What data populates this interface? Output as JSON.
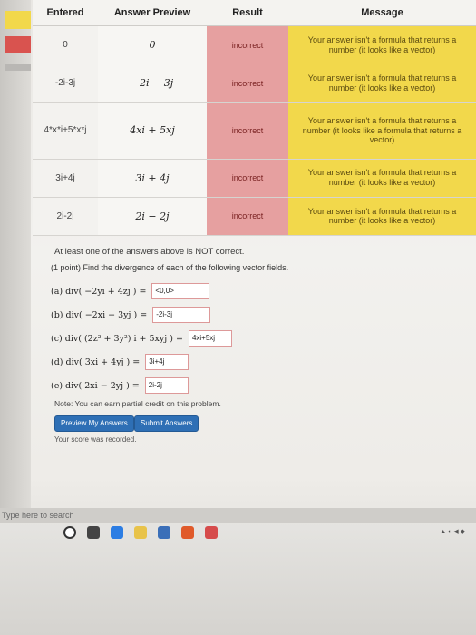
{
  "table": {
    "headers": {
      "entered": "Entered",
      "preview": "Answer Preview",
      "result": "Result",
      "message": "Message"
    },
    "rows": [
      {
        "entered": "0",
        "preview": "0",
        "result": "incorrect",
        "message": "Your answer isn't a formula that returns a number (it looks like a vector)"
      },
      {
        "entered": "-2i-3j",
        "preview": "−2i − 3j",
        "result": "incorrect",
        "message": "Your answer isn't a formula that returns a number (it looks like a vector)"
      },
      {
        "entered": "4*x*i+5*x*j",
        "preview": "4xi + 5xj",
        "result": "incorrect",
        "message": "Your answer isn't a formula that returns a number (it looks like a formula that returns a vector)"
      },
      {
        "entered": "3i+4j",
        "preview": "3i + 4j",
        "result": "incorrect",
        "message": "Your answer isn't a formula that returns a number (it looks like a vector)"
      },
      {
        "entered": "2i-2j",
        "preview": "2i − 2j",
        "result": "incorrect",
        "message": "Your answer isn't a formula that returns a number (it looks like a vector)"
      }
    ]
  },
  "alert": "At least one of the answers above is NOT correct.",
  "problem": {
    "intro": "(1 point) Find the divergence of each of the following vector fields.",
    "parts": [
      {
        "label": "(a) div( −2yi + 4zj ) =",
        "answer": "<0,0>"
      },
      {
        "label": "(b) div( −2xi − 3yj ) =",
        "answer": "-2i-3j"
      },
      {
        "label": "(c) div( (2z² + 3y²) i + 5xyj ) =",
        "answer": "4xi+5xj"
      },
      {
        "label": "(d) div( 3xi + 4yj ) =",
        "answer": "3i+4j"
      },
      {
        "label": "(e) div( 2xi − 2yj ) =",
        "answer": "2i-2j"
      }
    ]
  },
  "note": "Note: You can earn partial credit on this problem.",
  "buttons": {
    "preview": "Preview My Answers",
    "submit": "Submit Answers"
  },
  "recorded": "Your score was recorded.",
  "taskbar": {
    "search_placeholder": "Type here to search"
  },
  "colors": {
    "incorrect": "#e6a0a0",
    "message_bg": "#f2d84b",
    "button": "#2e6fb5"
  }
}
